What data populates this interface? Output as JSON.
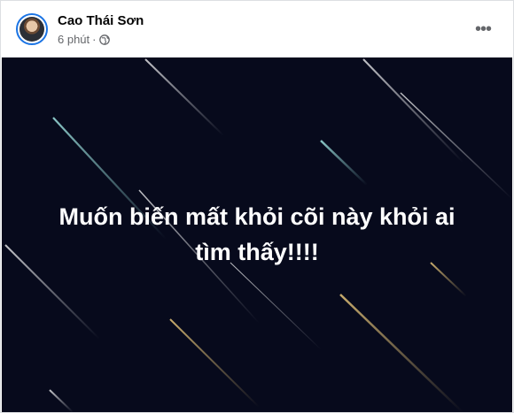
{
  "post": {
    "author_name": "Cao Thái Sơn",
    "timestamp": "6 phút",
    "separator": "·",
    "privacy_icon": "globe-icon",
    "more_icon": "more-options-icon",
    "more_glyph": "•••"
  },
  "image": {
    "caption_line1": "Muốn biến mất khỏi cõi này khỏi ai",
    "caption_line2": "tìm thấy!!!!",
    "background_color": "#070a1c"
  },
  "colors": {
    "avatar_ring": "#1b74e4",
    "meta_text": "#65676b"
  }
}
